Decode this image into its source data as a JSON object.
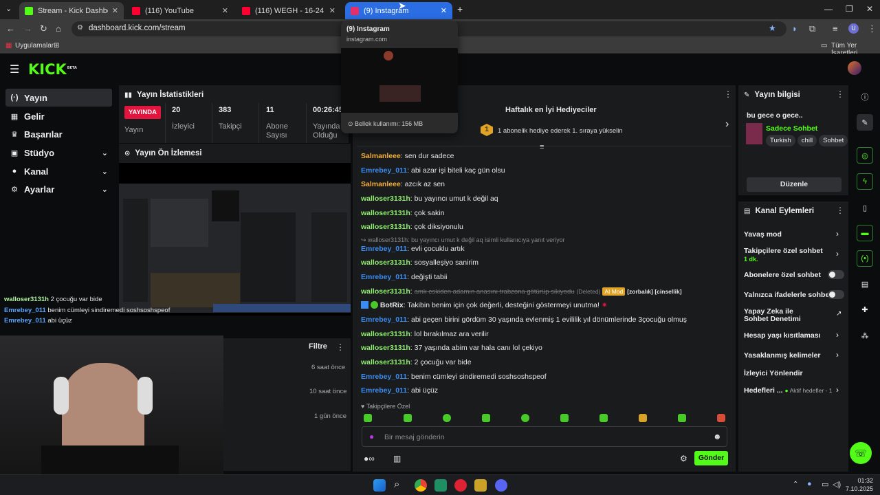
{
  "browser": {
    "tabs": [
      {
        "title": "Stream - Kick Dashboard",
        "favicon_color": "#53fc18"
      },
      {
        "title": "(116) YouTube",
        "favicon_color": "#ff0033"
      },
      {
        "title": "(116) WEGH - 16-24 (Offici...",
        "favicon_color": "#ff0033"
      },
      {
        "title": "(9) Instagram",
        "favicon_color": "#e1306c"
      }
    ],
    "url": "dashboard.kick.com/stream",
    "bookmarks": {
      "apps": "Uygulamalar",
      "all": "Tüm Yer İşaretleri"
    },
    "hover_card": {
      "title": "(9) Instagram",
      "domain": "instagram.com",
      "memory": "Bellek kullanımı: 156 MB"
    }
  },
  "kick": {
    "logo": "KICK",
    "beta": "BETA",
    "nav": [
      {
        "label": "Yayın",
        "icon": "(·)"
      },
      {
        "label": "Gelir",
        "icon": "▦"
      },
      {
        "label": "Başarılar",
        "icon": "🏆"
      },
      {
        "label": "Stüdyo",
        "icon": "▣"
      },
      {
        "label": "Kanal",
        "icon": "👤"
      },
      {
        "label": "Ayarlar",
        "icon": "⚙"
      }
    ],
    "stats": {
      "title": "Yayın İstatistikleri",
      "live": "YAYINDA",
      "live_label": "Yayın",
      "items": [
        {
          "value": "20",
          "label": "İzleyici"
        },
        {
          "value": "383",
          "label": "Takipçi"
        },
        {
          "value": "11",
          "label": "Abone Sayısı"
        },
        {
          "value": "00:26:45",
          "label": "Yayında Olduğu"
        }
      ]
    },
    "preview_title": "Yayın Ön İzlemesi",
    "activity": {
      "filter": "Filtre",
      "times": [
        "6 saat önce",
        "10 saat önce",
        "1 gün önce"
      ]
    },
    "overlay_chat": [
      {
        "user": "walloser3131h",
        "text": "2 çocuğu var bide"
      },
      {
        "user": "Emrebey_011",
        "text": "benim cümleyi sindiremedi soshsoshspeof"
      },
      {
        "user": "Emrebey_011",
        "text": "abi üçüz"
      }
    ],
    "chat": {
      "gifters_title": "Haftalık en İyi Hediyeciler",
      "gifters_rank": "1",
      "gifters_text": "1 abonelik hediye ederek 1. sıraya yükselin",
      "messages": [
        {
          "user": "Salmanleee",
          "text": "sen dur sadece",
          "color": "gold"
        },
        {
          "user": "Emrebey_011",
          "text": "abi azar işi biteli kaç gün olsu",
          "color": "blue"
        },
        {
          "user": "Salmanleee",
          "text": "azcık az sen",
          "color": "gold"
        },
        {
          "user": "walloser3131h",
          "text": "bu yayıncı umut k değil aq",
          "color": "green"
        },
        {
          "user": "walloser3131h",
          "text": "çok sakin",
          "color": "green"
        },
        {
          "user": "walloser3131h",
          "text": "çok diksiyonulu",
          "color": "green"
        }
      ],
      "reply_note": "walloser3131h: bu yayıncı umut k değil aq isimli kullanıcıya yanıt veriyor",
      "messages2": [
        {
          "user": "Emrebey_011",
          "text": "evli çocuklu artık",
          "color": "blue"
        },
        {
          "user": "walloser3131h",
          "text": "sosyalleşiyo sanirim",
          "color": "green"
        },
        {
          "user": "Emrebey_011",
          "text": "değişti tabii",
          "color": "blue"
        }
      ],
      "deleted": {
        "user": "walloser3131h",
        "text": "amk eskiden adamın anasını trabzona götürüp sikiyodu",
        "tag": "(Deleted)",
        "mod": "AI Mod",
        "reasons": "[zorbalık] [cinsellik]"
      },
      "bot": {
        "user": "BotRix",
        "text": "Takibin benim için çok değerli, desteğini göstermeyi unutma!"
      },
      "messages3": [
        {
          "user": "Emrebey_011",
          "text": "abi geçen birini gördüm 30 yaşında evlenmiş 1 evililik yıl dönümlerinde 3çocuğu olmuş",
          "color": "blue"
        },
        {
          "user": "walloser3131h",
          "text": "lol bırakılmaz ara verilir",
          "color": "green"
        },
        {
          "user": "walloser3131h",
          "text": "37 yaşında abim var hala canı lol çekiyo",
          "color": "green"
        },
        {
          "user": "walloser3131h",
          "text": "2 çocuğu var bide",
          "color": "green"
        },
        {
          "user": "Emrebey_011",
          "text": "benim cümleyi sindiremedi soshsoshspeof",
          "color": "blue"
        },
        {
          "user": "Emrebey_011",
          "text": "abi üçüz",
          "color": "blue"
        }
      ],
      "followers_only": "Takipçilere Özel",
      "placeholder": "Bir mesaj gönderin",
      "send": "Gönder"
    },
    "info": {
      "title": "Yayın bilgisi",
      "stream_title": "bu gece o gece..",
      "category": "Sadece Sohbet",
      "tags": [
        "Turkish",
        "chill",
        "Sohbet"
      ],
      "edit": "Düzenle"
    },
    "actions": {
      "title": "Kanal Eylemleri",
      "items": [
        {
          "label": "Yavaş mod",
          "kind": "chev"
        },
        {
          "label": "Takipçilere özel sohbet",
          "sub": "1 dk.",
          "kind": "chev"
        },
        {
          "label": "Abonelere özel sohbet",
          "kind": "toggle"
        },
        {
          "label": "Yalnızca ifadelerle sohbet",
          "kind": "toggle"
        },
        {
          "label": "Yapay Zeka ile Sohbet Denetimi",
          "kind": "ext"
        },
        {
          "label": "Hesap yaşı kısıtlaması",
          "kind": "chev"
        },
        {
          "label": "Yasaklanmış kelimeler",
          "kind": "chev"
        },
        {
          "label": "İzleyici Yönlendir",
          "kind": "none"
        },
        {
          "label": "Hedefleri ...",
          "sub": "Aktif hedefler - 1",
          "kind": "chev"
        }
      ]
    }
  },
  "taskbar": {
    "time": "01:32",
    "date": "7.10.2025"
  },
  "colors": {
    "kick_green": "#53fc18",
    "live_red": "#e3153f",
    "panel": "#191b1d"
  }
}
